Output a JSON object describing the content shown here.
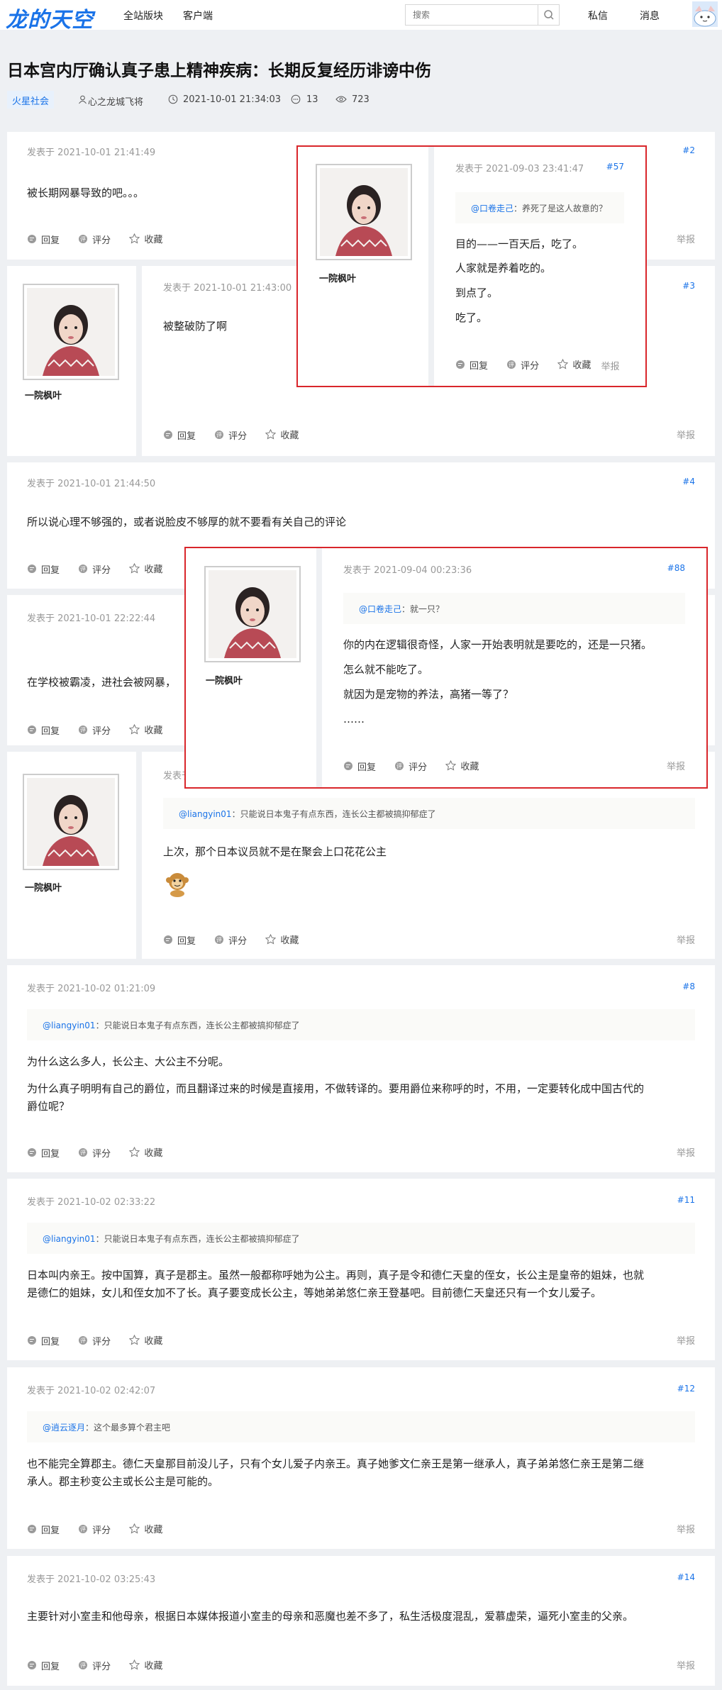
{
  "header": {
    "logo": "龙的天空",
    "nav": [
      "全站版块",
      "客户端"
    ],
    "search_placeholder": "搜索",
    "right_links": [
      "私信",
      "消息"
    ]
  },
  "thread": {
    "title": "日本宫内厅确认真子患上精神疾病：长期反复经历诽谤中伤",
    "tag": "火星社会",
    "author": "心之龙城飞将",
    "time": "2021-10-01 21:34:03",
    "comments": "13",
    "views": "723"
  },
  "actions": {
    "reply": "回复",
    "rate": "评分",
    "fav": "收藏",
    "report": "举报"
  },
  "posts": [
    {
      "date": "发表于 2021-10-01 21:41:49",
      "num": "#2",
      "text": "被长期网暴导致的吧。。。"
    },
    {
      "user": "一院枫叶",
      "date": "发表于 2021-10-01 21:43:00",
      "num": "#3",
      "text": "被整破防了啊"
    },
    {
      "date": "发表于 2021-10-01 21:44:50",
      "num": "#4",
      "text": "所以说心理不够强的，或者说脸皮不够厚的就不要看有关自己的评论"
    },
    {
      "date": "发表于 2021-10-01 22:22:44",
      "num": "",
      "text": "在学校被霸凌，进社会被网暴，"
    },
    {
      "user": "一院枫叶",
      "date": "发表于",
      "quote_user": "@liangyin01",
      "quote_text": "：只能说日本鬼子有点东西，连长公主都被搞抑郁症了",
      "text": "上次，那个日本议员就不是在聚会上口花花公主"
    },
    {
      "date": "发表于 2021-10-02 01:21:09",
      "num": "#8",
      "quote_user": "@liangyin01",
      "quote_text": "：只能说日本鬼子有点东西，连长公主都被搞抑郁症了",
      "lines": [
        "为什么这么多人，长公主、大公主不分呢。",
        "为什么真子明明有自己的爵位，而且翻译过来的时候是直接用，不做转译的。要用爵位来称呼的时，不用，一定要转化成中国古代的",
        "爵位呢？"
      ]
    },
    {
      "date": "发表于 2021-10-02 02:33:22",
      "num": "#11",
      "quote_user": "@liangyin01",
      "quote_text": "：只能说日本鬼子有点东西，连长公主都被搞抑郁症了",
      "lines": [
        "日本叫内亲王。按中国算，真子是郡主。虽然一般都称呼她为公主。再则，真子是令和德仁天皇的侄女，长公主是皇帝的姐妹，也就",
        "是德仁的姐妹，女儿和侄女加不了长。真子要变成长公主，等她弟弟悠仁亲王登基吧。目前德仁天皇还只有一个女儿爱子。"
      ]
    },
    {
      "date": "发表于 2021-10-02 02:42:07",
      "num": "#12",
      "quote_user": "@逍云逐月",
      "quote_text": "：这个最多算个君主吧",
      "lines": [
        "也不能完全算郡主。德仁天皇那目前没儿子，只有个女儿爱子内亲王。真子她爹文仁亲王是第一继承人，真子弟弟悠仁亲王是第二继",
        "承人。郡主秒变公主或长公主是可能的。"
      ]
    },
    {
      "date": "发表于 2021-10-02 03:25:43",
      "num": "#14",
      "text": "主要针对小室圭和他母亲，根据日本媒体报道小室圭的母亲和恶魔也差不多了，私生活极度混乱，爱慕虚荣，逼死小室圭的父亲。"
    }
  ],
  "popups": [
    {
      "user": "一院枫叶",
      "date": "发表于 2021-09-03 23:41:47",
      "num": "#57",
      "quote_user": "@口卷走己",
      "quote_text": "：养死了是这人故意的？",
      "lines": [
        "目的——一百天后，吃了。",
        "人家就是养着吃的。",
        "到点了。",
        "吃了。"
      ]
    },
    {
      "user": "一院枫叶",
      "date": "发表于 2021-09-04 00:23:36",
      "num": "#88",
      "quote_user": "@口卷走己",
      "quote_text": "：就一只？",
      "lines": [
        "你的内在逻辑很奇怪，人家一开始表明就是要吃的，还是一只猪。",
        "怎么就不能吃了。",
        "就因为是宠物的养法，高猪一等了？",
        "……"
      ]
    }
  ],
  "colors": {
    "accent": "#1a73e8",
    "popup_border": "#d9262b",
    "background": "#eef0f3"
  }
}
